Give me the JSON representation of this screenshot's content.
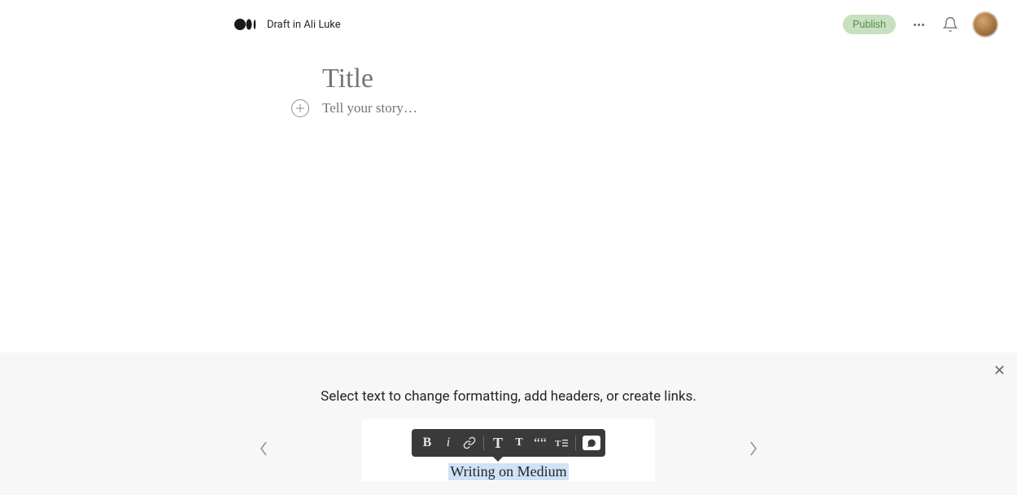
{
  "header": {
    "draft_label": "Draft in Ali Luke",
    "publish_label": "Publish"
  },
  "editor": {
    "title_placeholder": "Title",
    "body_placeholder": "Tell your story…"
  },
  "hint": {
    "text": "Select text to change formatting, add headers, or create links.",
    "sample_text": "Writing on Medium",
    "toolbar": {
      "bold": "B",
      "italic": "i",
      "bigT": "T",
      "smallT": "T",
      "quote": "““"
    }
  }
}
